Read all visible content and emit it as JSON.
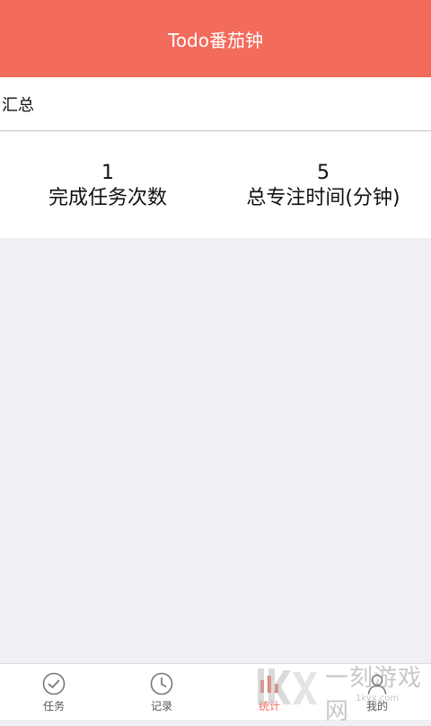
{
  "header": {
    "title": "Todo番茄钟"
  },
  "summary": {
    "label": "汇总"
  },
  "stats": [
    {
      "value": "1",
      "label": "完成任务次数"
    },
    {
      "value": "5",
      "label": "总专注时间(分钟)"
    }
  ],
  "tabs": [
    {
      "label": "任务",
      "icon": "check-circle-icon"
    },
    {
      "label": "记录",
      "icon": "clock-icon"
    },
    {
      "label": "统计",
      "icon": "bar-chart-icon",
      "active": true
    },
    {
      "label": "我的",
      "icon": "user-icon"
    }
  ],
  "watermark": {
    "text": "一刻游戏网",
    "url": "1kyx.com"
  },
  "colors": {
    "accent": "#f26b5b",
    "background": "#efeff4"
  }
}
